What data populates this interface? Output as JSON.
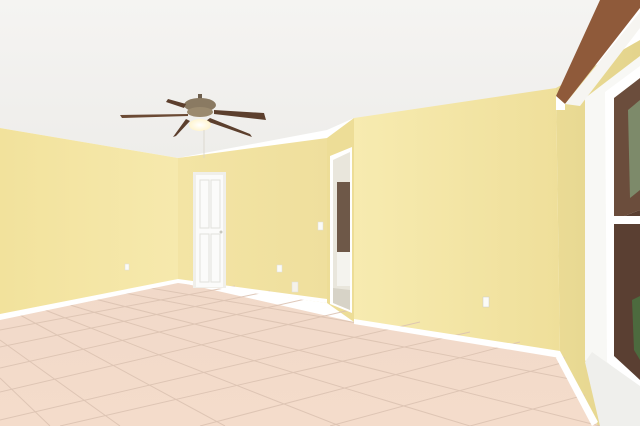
{
  "scene": {
    "description_free": true,
    "palette": {
      "ceiling": "#f3f2f0",
      "wall_light": "#f6eaa9",
      "wall_mid": "#efe19c",
      "wall_shadow": "#e6d690",
      "floor_tile": "#f3d9c7",
      "grout": "#d9bfae",
      "baseboard": "#ffffff",
      "door": "#fbfbfb",
      "window_frame": "#ffffff",
      "trim_brown": "#8f5a3a",
      "fan_body": "#7a6a55",
      "fan_light": "#fff8dc"
    }
  }
}
